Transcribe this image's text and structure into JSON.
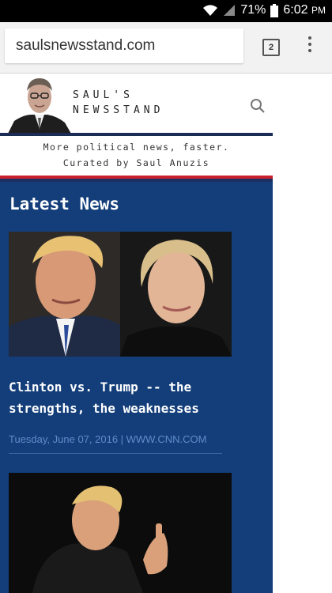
{
  "status": {
    "battery": "71%",
    "time": "6:02",
    "ampm": "PM"
  },
  "browser": {
    "url": "saulsnewsstand.com",
    "tab_count": "2",
    "menu_icon": "overflow-menu-icon"
  },
  "site": {
    "logo_line1": "SAUL'S",
    "logo_line2": "NEWSSTAND",
    "tagline_line1": "More political news, faster.",
    "tagline_line2": "Curated by Saul Anuzis",
    "colors": {
      "navy": "#133e7a",
      "red": "#c8202d",
      "meta": "#5f8cc8"
    }
  },
  "main": {
    "section_title": "Latest News",
    "articles": [
      {
        "title": "Clinton vs. Trump -- the strengths, the weaknesses",
        "meta": "Tuesday, June 07, 2016 | WWW.CNN.COM"
      }
    ]
  }
}
